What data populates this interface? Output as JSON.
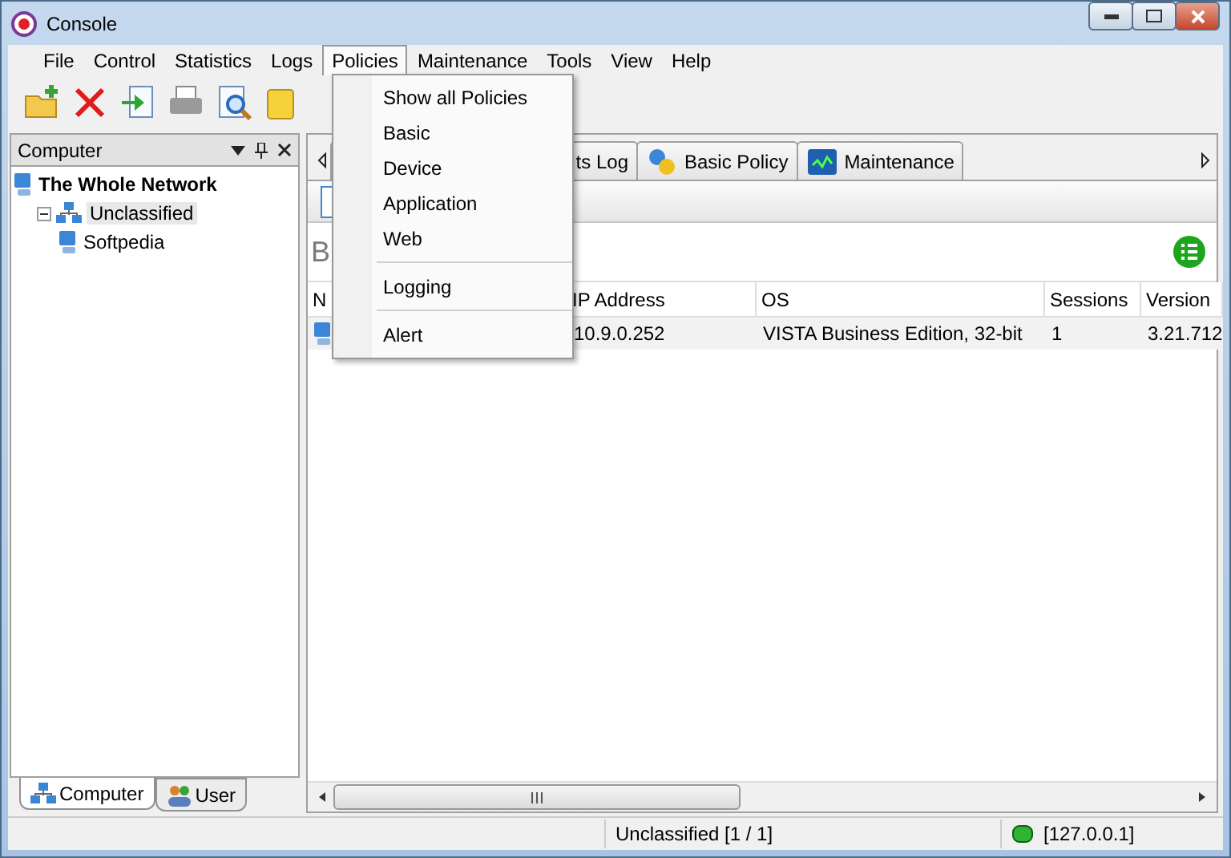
{
  "window": {
    "title": "Console"
  },
  "menu_bar": [
    {
      "label": "File",
      "selected": false
    },
    {
      "label": "Control",
      "selected": false
    },
    {
      "label": "Statistics",
      "selected": false
    },
    {
      "label": "Logs",
      "selected": false
    },
    {
      "label": "Policies",
      "selected": true
    },
    {
      "label": "Maintenance",
      "selected": false
    },
    {
      "label": "Tools",
      "selected": false
    },
    {
      "label": "View",
      "selected": false
    },
    {
      "label": "Help",
      "selected": false
    }
  ],
  "policies_menu": [
    {
      "kind": "item",
      "label": "Show all Policies"
    },
    {
      "kind": "item",
      "label": "Basic"
    },
    {
      "kind": "item",
      "label": "Device"
    },
    {
      "kind": "item",
      "label": "Application"
    },
    {
      "kind": "item",
      "label": "Web"
    },
    {
      "kind": "separator"
    },
    {
      "kind": "item",
      "label": "Logging"
    },
    {
      "kind": "separator"
    },
    {
      "kind": "item",
      "label": "Alert"
    }
  ],
  "computer_panel": {
    "title": "Computer",
    "tree": [
      {
        "label": "The Whole Network",
        "selected": false,
        "children": [
          {
            "label": "Unclassified",
            "selected": true,
            "expanded": true,
            "children": [
              {
                "label": "Softpedia",
                "selected": false
              }
            ]
          }
        ]
      }
    ],
    "tabs": [
      {
        "label": "Computer",
        "selected": true
      },
      {
        "label": "User",
        "selected": false
      }
    ]
  },
  "tabs": [
    {
      "label": "ts Log",
      "selected": false
    },
    {
      "label": "Basic Policy",
      "selected": false
    },
    {
      "label": "Maintenance",
      "selected": false
    }
  ],
  "heading": "B",
  "table": {
    "columns": [
      "N",
      "IP Address",
      "OS",
      "Sessions",
      "Version"
    ],
    "rows": [
      {
        "cells": [
          "",
          "10.9.0.252",
          "VISTA Business Edition, 32-bit",
          "1",
          "3.21.712"
        ]
      }
    ]
  },
  "status_bar": {
    "group": "Unclassified [1 / 1]",
    "address": "[127.0.0.1]",
    "connected": true
  }
}
